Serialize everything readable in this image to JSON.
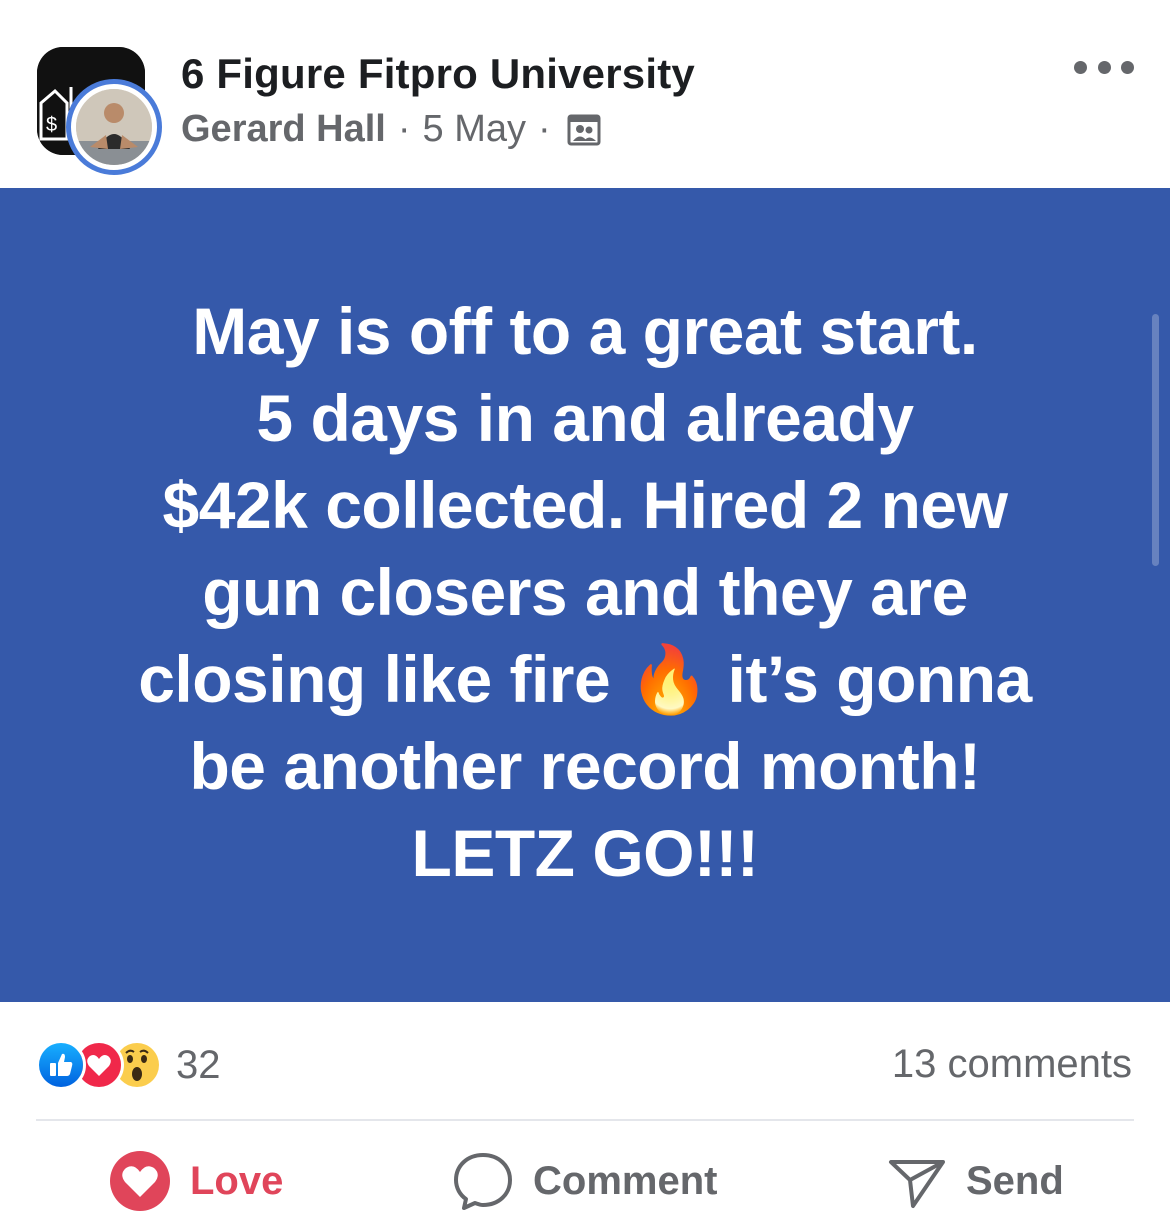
{
  "header": {
    "group_name": "6 Figure Fitpro University",
    "author": "Gerard Hall",
    "separator": "·",
    "date": "5 May",
    "privacy_icon": "members-icon",
    "more_icon": "more-horizontal-icon"
  },
  "post": {
    "background_color": "#3559aa",
    "lines": [
      "May is off to a great start.",
      "5 days in and already",
      "$42k collected. Hired 2 new",
      "gun closers and they are",
      "closing like fire 🔥 it’s gonna",
      "be another record month!",
      "LETZ GO!!!"
    ]
  },
  "stats": {
    "reaction_icons": [
      "like-icon",
      "love-icon",
      "wow-icon"
    ],
    "reaction_count": "32",
    "comments": "13 comments"
  },
  "actions": {
    "love_label": "Love",
    "comment_label": "Comment",
    "send_label": "Send"
  },
  "colors": {
    "love": "#e0455a",
    "like": "#1877f2",
    "text_secondary": "#65676b"
  }
}
